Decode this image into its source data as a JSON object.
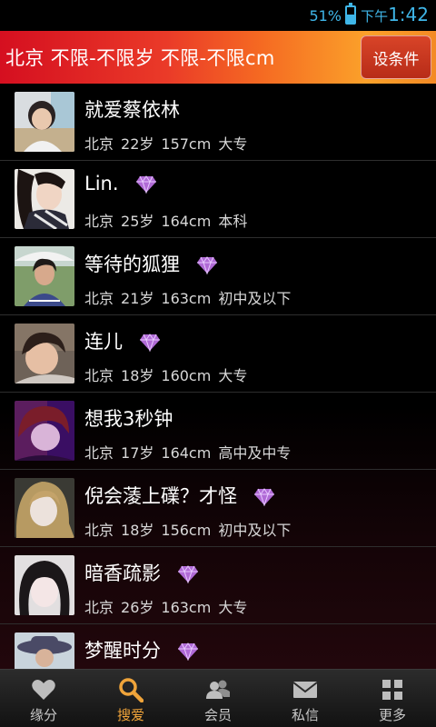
{
  "status_bar": {
    "battery": "51%",
    "ampm": "下午",
    "time": "1:42"
  },
  "filter": {
    "text": "北京 不限-不限岁 不限-不限cm",
    "button_label": "设条件"
  },
  "users": [
    {
      "nick": "就爱蔡依林",
      "vip": false,
      "city": "北京",
      "age": "22岁",
      "height": "157cm",
      "edu": "大专"
    },
    {
      "nick": "Lin.",
      "vip": true,
      "city": "北京",
      "age": "25岁",
      "height": "164cm",
      "edu": "本科"
    },
    {
      "nick": "等待的狐狸",
      "vip": true,
      "city": "北京",
      "age": "21岁",
      "height": "163cm",
      "edu": "初中及以下"
    },
    {
      "nick": "连儿",
      "vip": true,
      "city": "北京",
      "age": "18岁",
      "height": "160cm",
      "edu": "大专"
    },
    {
      "nick": "想我3秒钟",
      "vip": false,
      "city": "北京",
      "age": "17岁",
      "height": "164cm",
      "edu": "高中及中专"
    },
    {
      "nick": "倪会蓤上礏？才怪",
      "vip": true,
      "city": "北京",
      "age": "18岁",
      "height": "156cm",
      "edu": "初中及以下"
    },
    {
      "nick": "暗香疏影",
      "vip": true,
      "city": "北京",
      "age": "26岁",
      "height": "163cm",
      "edu": "大专"
    },
    {
      "nick": "梦醒时分",
      "vip": true,
      "city": "",
      "age": "",
      "height": "",
      "edu": ""
    }
  ],
  "tabs": [
    {
      "label": "缘分",
      "icon": "heart-icon",
      "active": false
    },
    {
      "label": "搜爱",
      "icon": "search-icon",
      "active": true
    },
    {
      "label": "会员",
      "icon": "members-icon",
      "active": false
    },
    {
      "label": "私信",
      "icon": "mail-icon",
      "active": false
    },
    {
      "label": "更多",
      "icon": "grid-icon",
      "active": false
    }
  ],
  "colors": {
    "accent": "#3fb6e8",
    "active_tab": "#f0a43a",
    "gem": "#b06ad6"
  }
}
